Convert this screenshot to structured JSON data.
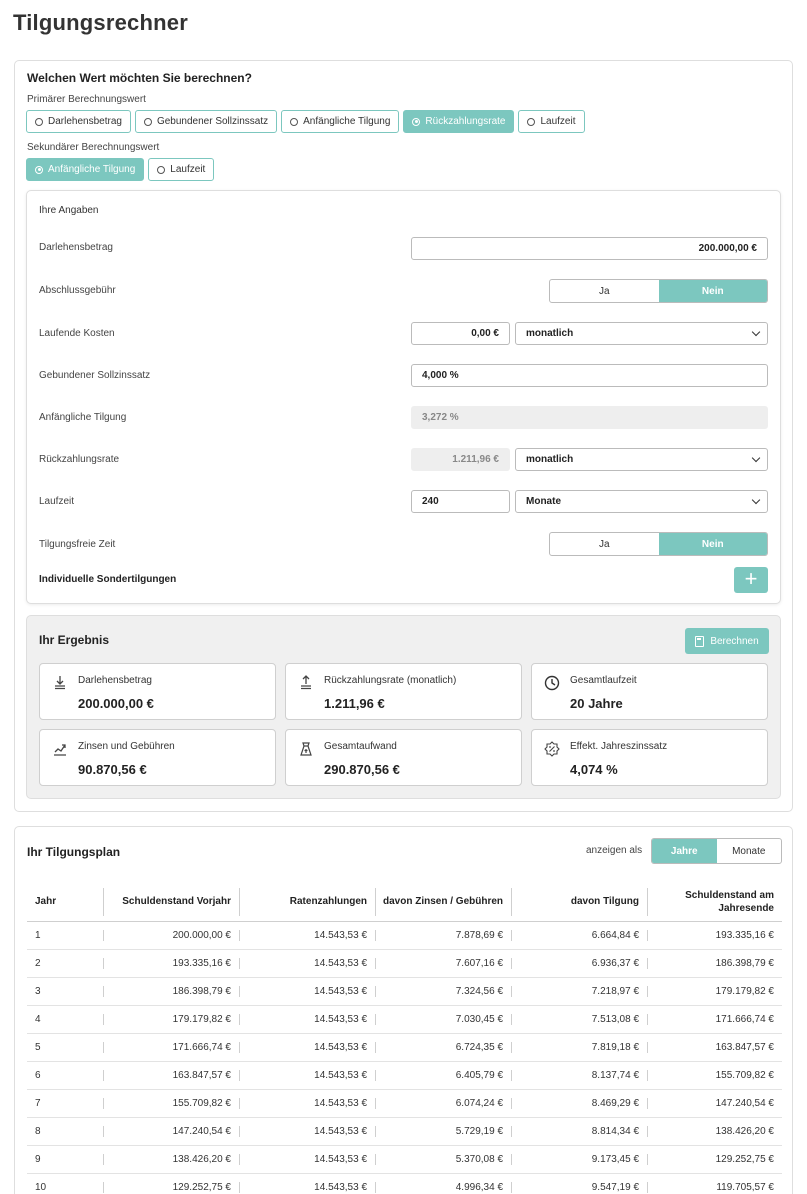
{
  "page_title": "Tilgungsrechner",
  "config": {
    "question": "Welchen Wert möchten Sie berechnen?",
    "primary_label": "Primärer Berechnungswert",
    "primary_options": [
      "Darlehensbetrag",
      "Gebundener Sollzinssatz",
      "Anfängliche Tilgung",
      "Rückzahlungsrate",
      "Laufzeit"
    ],
    "primary_selected": "Rückzahlungsrate",
    "secondary_label": "Sekundärer Berechnungswert",
    "secondary_options": [
      "Anfängliche Tilgung",
      "Laufzeit"
    ],
    "secondary_selected": "Anfängliche Tilgung"
  },
  "inputs": {
    "heading": "Ihre Angaben",
    "darlehensbetrag": {
      "label": "Darlehensbetrag",
      "value": "200.000,00 €"
    },
    "abschlussgebuehr": {
      "label": "Abschlussgebühr",
      "yes": "Ja",
      "no": "Nein",
      "selected": "Nein"
    },
    "laufende_kosten": {
      "label": "Laufende Kosten",
      "value": "0,00 €",
      "period": "monatlich"
    },
    "sollzinssatz": {
      "label": "Gebundener Sollzinssatz",
      "value": "4,000 %"
    },
    "anfaengliche_tilgung": {
      "label": "Anfängliche Tilgung",
      "value": "3,272 %"
    },
    "rueckzahlungsrate": {
      "label": "Rückzahlungsrate",
      "value": "1.211,96 €",
      "period": "monatlich"
    },
    "laufzeit": {
      "label": "Laufzeit",
      "value": "240",
      "unit": "Monate"
    },
    "tilgungsfreie_zeit": {
      "label": "Tilgungsfreie Zeit",
      "yes": "Ja",
      "no": "Nein",
      "selected": "Nein"
    },
    "sondertilgungen": {
      "label": "Individuelle Sondertilgungen",
      "button": "+"
    }
  },
  "result": {
    "heading": "Ihr Ergebnis",
    "calc_button": "Berechnen",
    "items": [
      {
        "icon": "loan-amount-icon",
        "label": "Darlehensbetrag",
        "value": "200.000,00 €"
      },
      {
        "icon": "repayment-rate-icon",
        "label": "Rückzahlungsrate (monatlich)",
        "value": "1.211,96 €"
      },
      {
        "icon": "clock-icon",
        "label": "Gesamtlaufzeit",
        "value": "20 Jahre"
      },
      {
        "icon": "interest-chart-icon",
        "label": "Zinsen und Gebühren",
        "value": "90.870,56 €"
      },
      {
        "icon": "total-cost-icon",
        "label": "Gesamtaufwand",
        "value": "290.870,56 €"
      },
      {
        "icon": "percent-badge-icon",
        "label": "Effekt. Jahreszinssatz",
        "value": "4,074 %"
      }
    ]
  },
  "plan": {
    "heading": "Ihr Tilgungsplan",
    "show_as_label": "anzeigen als",
    "view_options": [
      "Jahre",
      "Monate"
    ],
    "view_selected": "Jahre",
    "columns": [
      "Jahr",
      "Schuldenstand Vorjahr",
      "Ratenzahlungen",
      "davon Zinsen / Gebühren",
      "davon Tilgung",
      "Schuldenstand am Jahresende"
    ],
    "rows": [
      [
        "1",
        "200.000,00 €",
        "14.543,53 €",
        "7.878,69 €",
        "6.664,84 €",
        "193.335,16 €"
      ],
      [
        "2",
        "193.335,16 €",
        "14.543,53 €",
        "7.607,16 €",
        "6.936,37 €",
        "186.398,79 €"
      ],
      [
        "3",
        "186.398,79 €",
        "14.543,53 €",
        "7.324,56 €",
        "7.218,97 €",
        "179.179,82 €"
      ],
      [
        "4",
        "179.179,82 €",
        "14.543,53 €",
        "7.030,45 €",
        "7.513,08 €",
        "171.666,74 €"
      ],
      [
        "5",
        "171.666,74 €",
        "14.543,53 €",
        "6.724,35 €",
        "7.819,18 €",
        "163.847,57 €"
      ],
      [
        "6",
        "163.847,57 €",
        "14.543,53 €",
        "6.405,79 €",
        "8.137,74 €",
        "155.709,82 €"
      ],
      [
        "7",
        "155.709,82 €",
        "14.543,53 €",
        "6.074,24 €",
        "8.469,29 €",
        "147.240,54 €"
      ],
      [
        "8",
        "147.240,54 €",
        "14.543,53 €",
        "5.729,19 €",
        "8.814,34 €",
        "138.426,20 €"
      ],
      [
        "9",
        "138.426,20 €",
        "14.543,53 €",
        "5.370,08 €",
        "9.173,45 €",
        "129.252,75 €"
      ],
      [
        "10",
        "129.252,75 €",
        "14.543,53 €",
        "4.996,34 €",
        "9.547,19 €",
        "119.705,57 €"
      ]
    ]
  },
  "colors": {
    "accent": "#7cc7bf",
    "panel_bg": "#f0f0f0",
    "border": "#dedede"
  }
}
